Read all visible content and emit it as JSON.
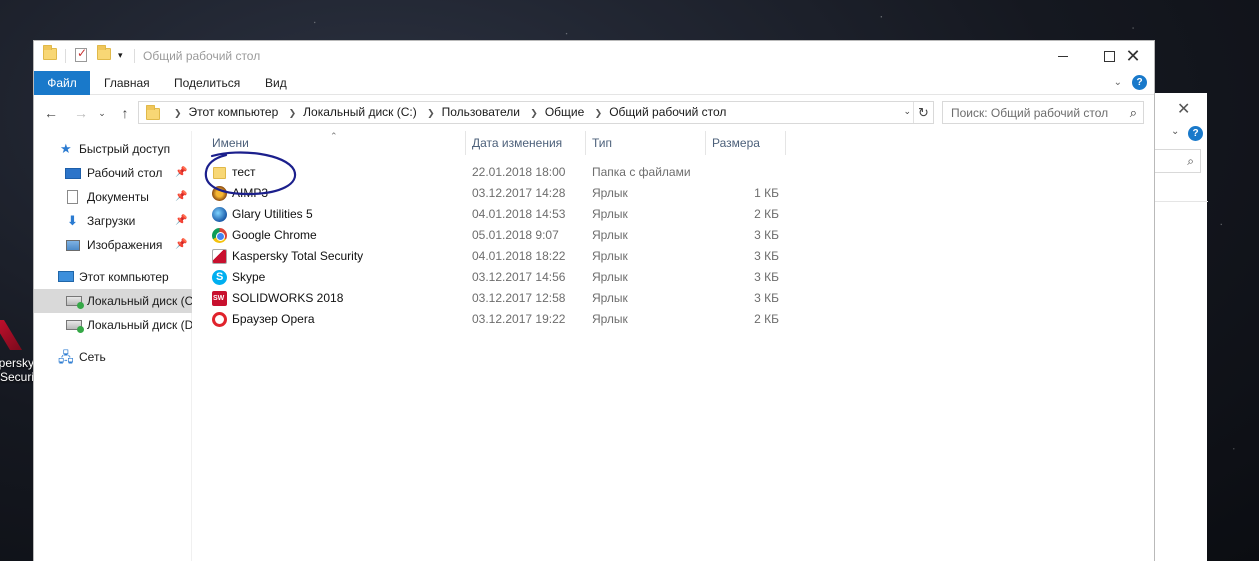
{
  "window": {
    "title": "Общий рабочий стол",
    "minimize_glyph": "",
    "maximize_glyph": "",
    "close_glyph": "✕"
  },
  "ribbon": {
    "tabs": [
      "Файл",
      "Главная",
      "Поделиться",
      "Вид"
    ]
  },
  "address": {
    "crumbs": [
      "Этот компьютер",
      "Локальный диск (C:)",
      "Пользователи",
      "Общие",
      "Общий рабочий стол"
    ]
  },
  "search": {
    "placeholder": "Поиск: Общий рабочий стол"
  },
  "sidebar": {
    "items": [
      {
        "label": "Быстрый доступ",
        "icon": "star-icon",
        "pinned": false
      },
      {
        "label": "Рабочий стол",
        "icon": "desktop-icon",
        "pinned": true
      },
      {
        "label": "Документы",
        "icon": "documents-icon",
        "pinned": true
      },
      {
        "label": "Загрузки",
        "icon": "downloads-icon",
        "pinned": true
      },
      {
        "label": "Изображения",
        "icon": "pictures-icon",
        "pinned": true
      },
      {
        "label": "Этот компьютер",
        "icon": "computer-icon",
        "pinned": false
      },
      {
        "label": "Локальный диск (C:)",
        "icon": "drive-icon",
        "pinned": false,
        "selected": true
      },
      {
        "label": "Локальный диск (D:)",
        "icon": "drive-icon",
        "pinned": false
      },
      {
        "label": "Сеть",
        "icon": "network-icon",
        "pinned": false
      }
    ]
  },
  "columns": [
    "Имени",
    "Дата изменения",
    "Тип",
    "Размера"
  ],
  "files": [
    {
      "name": "тест",
      "date": "22.01.2018 18:00",
      "type": "Папка с файлами",
      "size": "",
      "icon": "folder-icon"
    },
    {
      "name": "AIMP3",
      "date": "03.12.2017 14:28",
      "type": "Ярлык",
      "size": "1 КБ",
      "icon": "aimp-icon"
    },
    {
      "name": "Glary Utilities 5",
      "date": "04.01.2018 14:53",
      "type": "Ярлык",
      "size": "2 КБ",
      "icon": "glary-icon"
    },
    {
      "name": "Google Chrome",
      "date": "05.01.2018 9:07",
      "type": "Ярлык",
      "size": "3 КБ",
      "icon": "chrome-icon"
    },
    {
      "name": "Kaspersky Total Security",
      "date": "04.01.2018 18:22",
      "type": "Ярлык",
      "size": "3 КБ",
      "icon": "kaspersky-icon"
    },
    {
      "name": "Skype",
      "date": "03.12.2017 14:56",
      "type": "Ярлык",
      "size": "3 КБ",
      "icon": "skype-icon"
    },
    {
      "name": "SOLIDWORKS 2018",
      "date": "03.12.2017 12:58",
      "type": "Ярлык",
      "size": "3 КБ",
      "icon": "solidworks-icon"
    },
    {
      "name": "Браузер Opera",
      "date": "03.12.2017 19:22",
      "type": "Ярлык",
      "size": "2 КБ",
      "icon": "opera-icon"
    }
  ],
  "desktop": {
    "icon_label_line1": "persky",
    "icon_label_line2": "Securi"
  },
  "colors": {
    "accent": "#1979ca",
    "selection": "#d9d9d9",
    "header_text": "#4c607a"
  }
}
